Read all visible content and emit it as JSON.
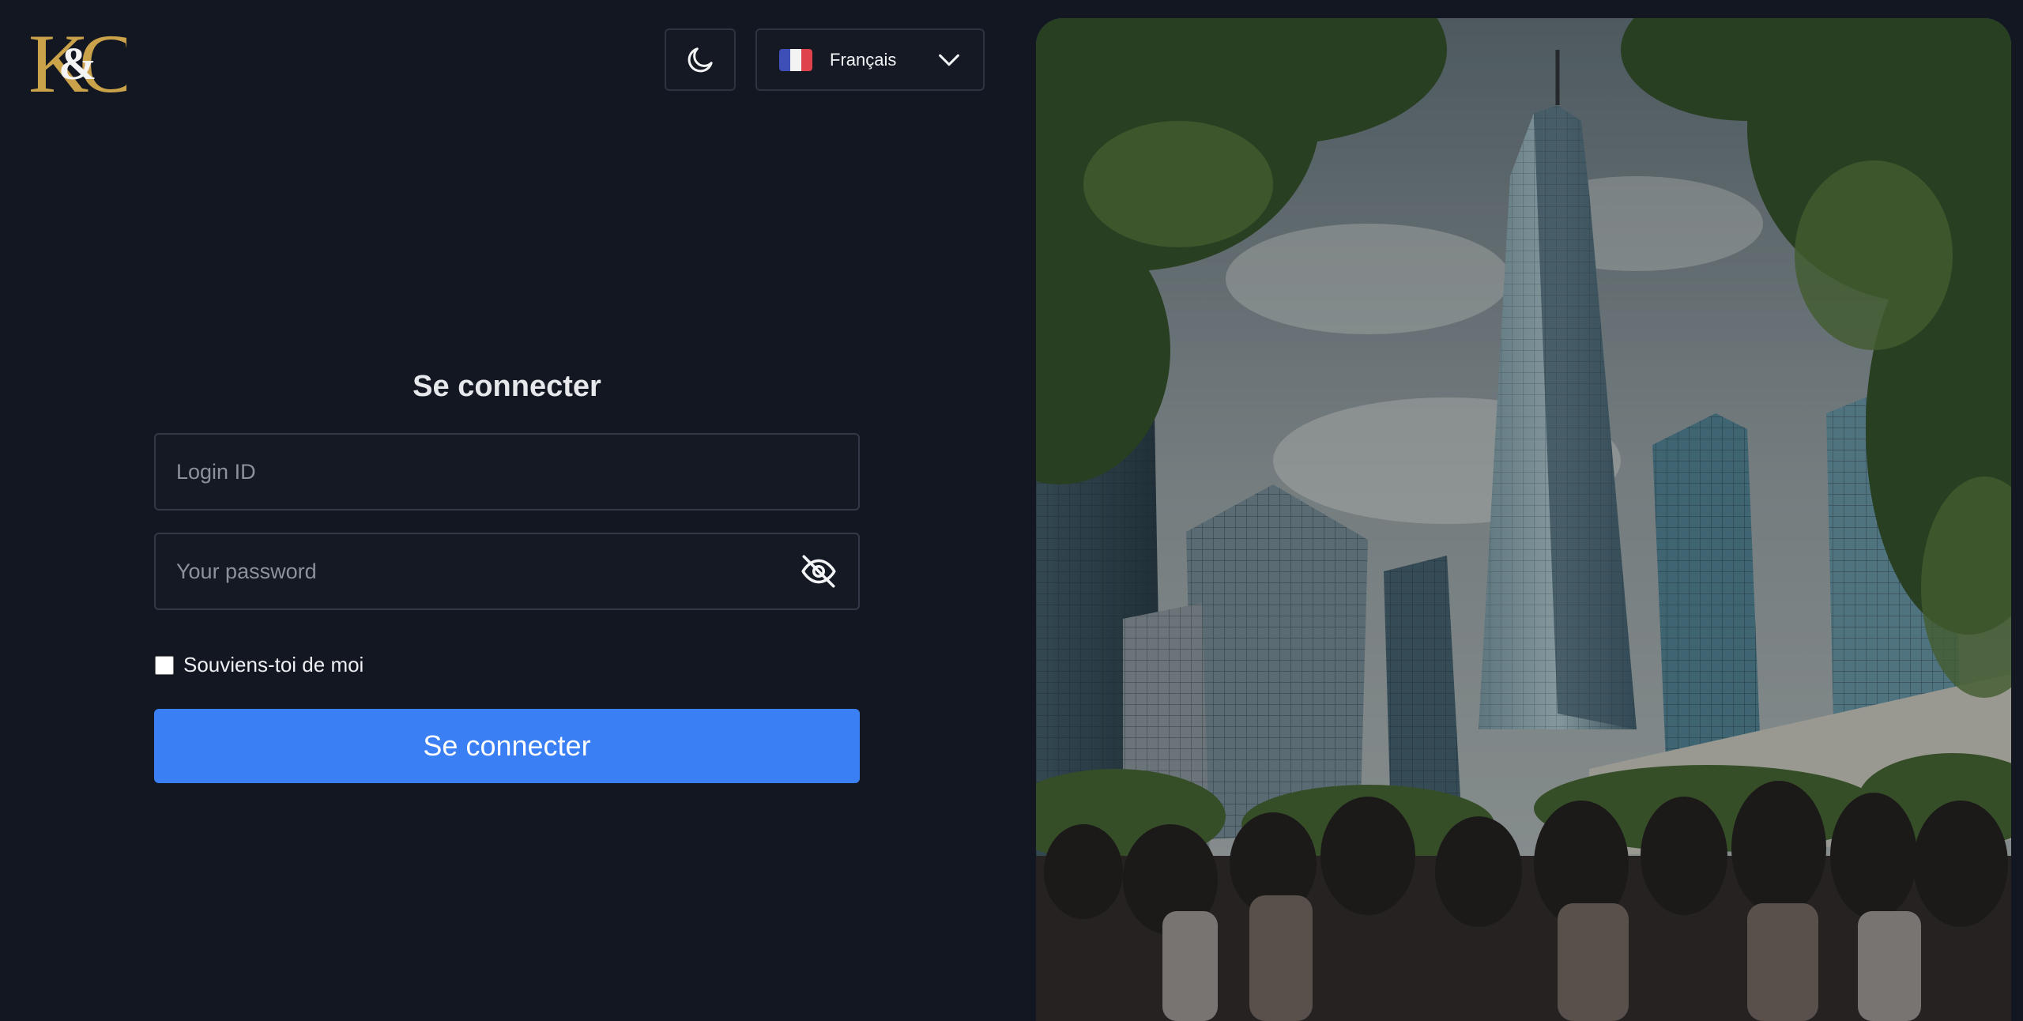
{
  "logo": {
    "text": "K&C",
    "accent_color": "#c9a24a"
  },
  "theme_toggle": {
    "icon": "moon-icon"
  },
  "language": {
    "selected": "Français",
    "flag": "france-flag",
    "chevron_icon": "chevron-down-icon"
  },
  "login_form": {
    "title": "Se connecter",
    "login_placeholder": "Login ID",
    "login_value": "",
    "password_placeholder": "Your password",
    "password_value": "",
    "visibility_icon": "eye-off-icon",
    "remember_label": "Souviens-toi de moi",
    "remember_checked": false,
    "submit_label": "Se connecter"
  },
  "colors": {
    "background": "#131722",
    "primary": "#3b7ff5",
    "border": "#323846"
  },
  "hero_image": {
    "subject": "city-skyscrapers-with-crowd"
  }
}
